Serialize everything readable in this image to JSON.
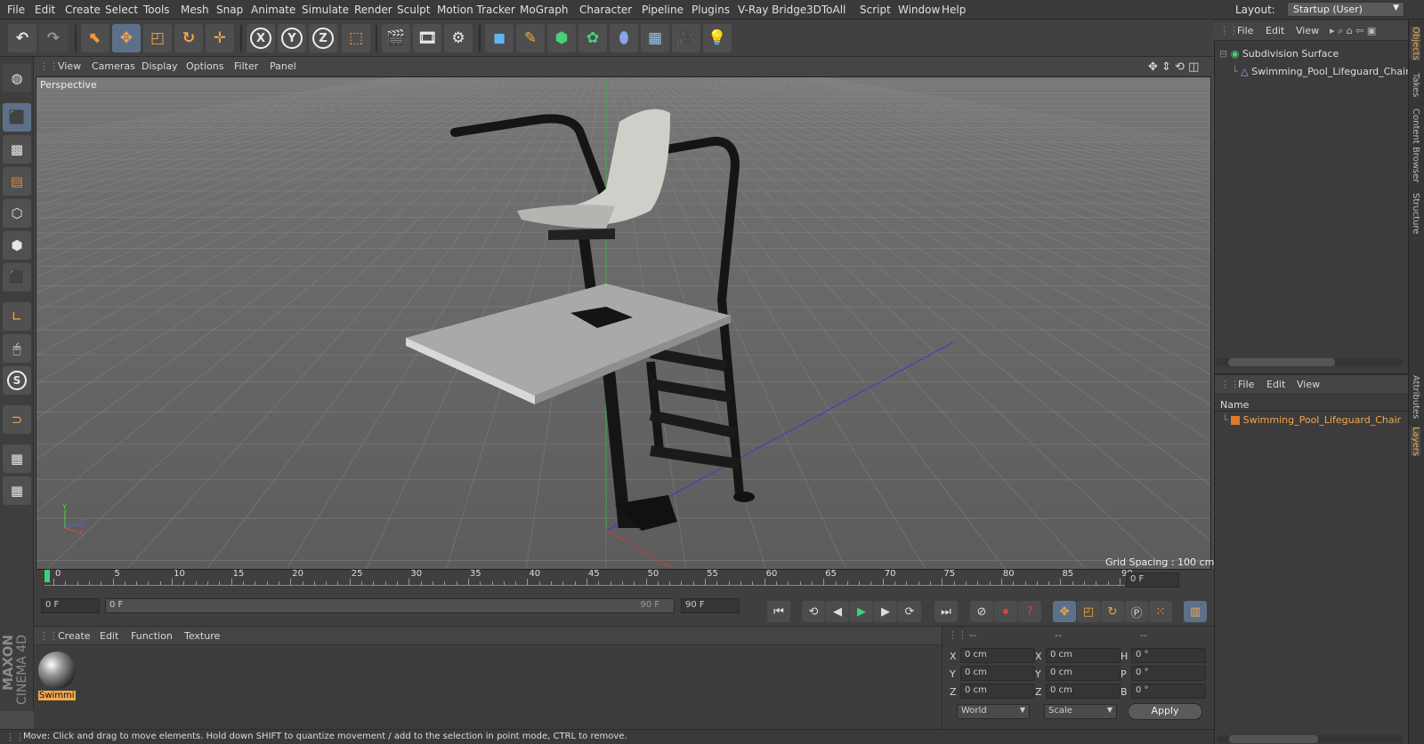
{
  "menu": [
    "File",
    "Edit",
    "Create",
    "Select",
    "Tools",
    "Mesh",
    "Snap",
    "Animate",
    "Simulate",
    "Render",
    "Sculpt",
    "Motion Tracker",
    "MoGraph",
    "Character",
    "Pipeline",
    "Plugins",
    "V-Ray Bridge",
    "3DToAll",
    "Script",
    "Window",
    "Help"
  ],
  "layout": {
    "label": "Layout:",
    "value": "Startup (User)"
  },
  "toolbar": {
    "x_axis": "X",
    "y_axis": "Y",
    "z_axis": "Z"
  },
  "viewport": {
    "menu": [
      "View",
      "Cameras",
      "Display",
      "Options",
      "Filter",
      "Panel"
    ],
    "label": "Perspective",
    "grid_spacing": "Grid Spacing : 100 cm",
    "axis_y": "Y",
    "axis_z": "Z",
    "axis_x": "X"
  },
  "timeline": {
    "ticks": [
      "0",
      "5",
      "10",
      "15",
      "20",
      "25",
      "30",
      "35",
      "40",
      "45",
      "50",
      "55",
      "60",
      "65",
      "70",
      "75",
      "80",
      "85",
      "90"
    ],
    "current_frame": "0 F",
    "start_frame": "0 F",
    "range_start": "0 F",
    "range_end": "90 F",
    "end_frame": "90 F"
  },
  "material": {
    "menu": [
      "Create",
      "Edit",
      "Function",
      "Texture"
    ],
    "item_label": "Swimmi"
  },
  "attributes": {
    "headers": [
      "--",
      "--",
      "--"
    ],
    "rows": [
      {
        "l1": "X",
        "v1": "0 cm",
        "l2": "X",
        "v2": "0 cm",
        "l3": "H",
        "v3": "0 °"
      },
      {
        "l1": "Y",
        "v1": "0 cm",
        "l2": "Y",
        "v2": "0 cm",
        "l3": "P",
        "v3": "0 °"
      },
      {
        "l1": "Z",
        "v1": "0 cm",
        "l2": "Z",
        "v2": "0 cm",
        "l3": "B",
        "v3": "0 °"
      }
    ],
    "coord_mode": "World",
    "size_mode": "Scale",
    "apply": "Apply"
  },
  "status": "Move: Click and drag to move elements. Hold down SHIFT to quantize movement / add to the selection in point mode, CTRL to remove.",
  "objects": {
    "menu": [
      "File",
      "Edit",
      "View"
    ],
    "tree": [
      {
        "name": "Subdivision Surface"
      },
      {
        "name": "Swimming_Pool_Lifeguard_Chair"
      }
    ]
  },
  "layers": {
    "menu": [
      "File",
      "Edit",
      "View"
    ],
    "header": "Name",
    "items": [
      {
        "name": "Swimming_Pool_Lifeguard_Chair",
        "color": "#e07a2a"
      }
    ]
  },
  "side_tabs": [
    "Objects",
    "Takes",
    "Content Browser",
    "Structure",
    "Attributes",
    "Layers"
  ],
  "logo": {
    "brand": "MAXON",
    "product": "CINEMA 4D"
  },
  "colors": {
    "accent": "#f2a74a",
    "selection": "#5d7089",
    "layer_orange": "#e07a2a"
  }
}
